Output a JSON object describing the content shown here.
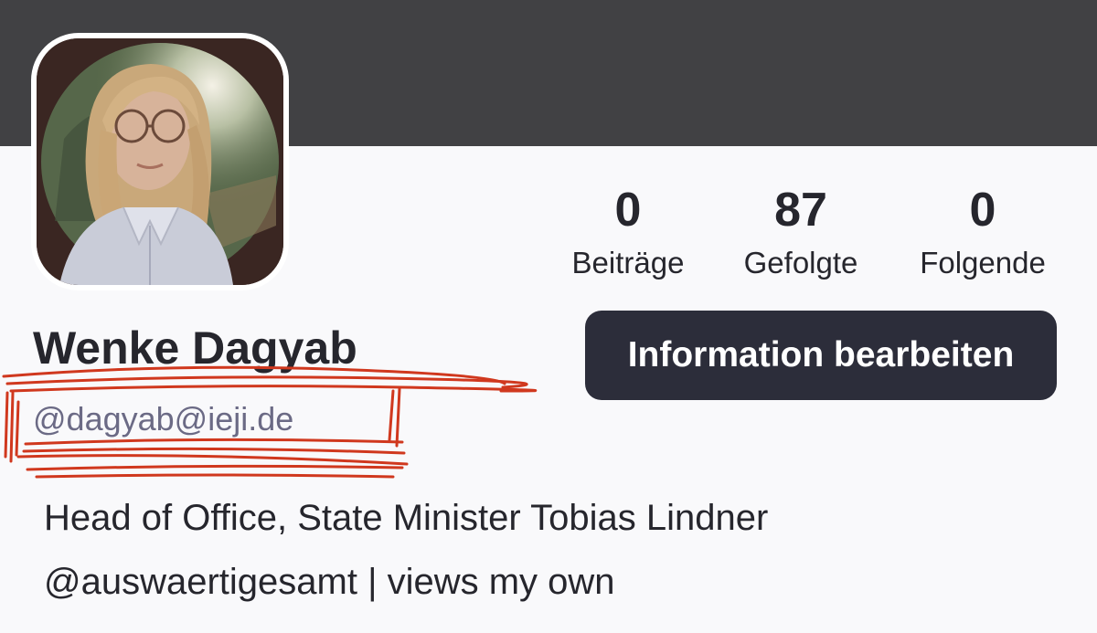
{
  "profile": {
    "display_name": "Wenke Dagyab",
    "handle": "@dagyab@ieji.de",
    "bio_line1": "Head of Office, State Minister Tobias Lindner",
    "bio_line2": "@auswaertigesamt | views my own"
  },
  "stats": {
    "posts": {
      "value": "0",
      "label": "Beiträge"
    },
    "following": {
      "value": "87",
      "label": "Gefolgte"
    },
    "followers": {
      "value": "0",
      "label": "Folgende"
    }
  },
  "actions": {
    "edit_label": "Information bearbeiten"
  },
  "colors": {
    "banner": "#414144",
    "background": "#f9f9fb",
    "button": "#2c2d3a",
    "text": "#26262d",
    "handle": "#6b6a85",
    "annotation": "#d0381e"
  }
}
